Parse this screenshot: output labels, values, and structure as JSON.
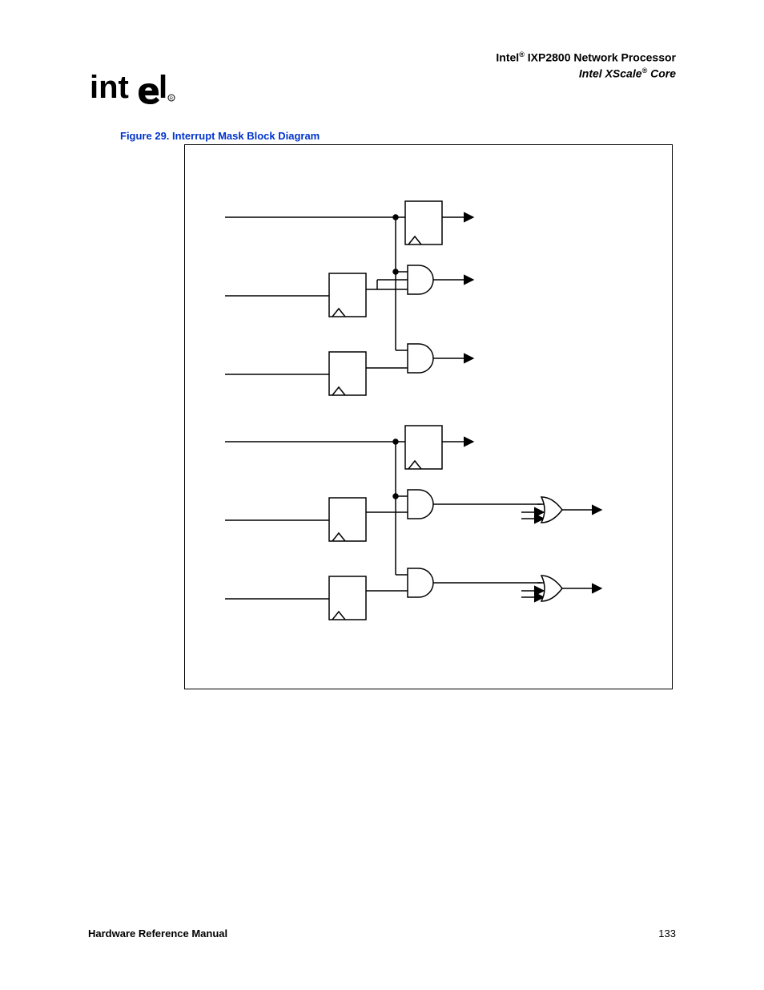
{
  "header": {
    "company": "Intel",
    "reg1": "®",
    "product": " IXP2800 Network Processor",
    "subline_prefix": "Intel XScale",
    "reg2": "®",
    "subline_suffix": " Core"
  },
  "figure": {
    "label": "Figure 29. Interrupt Mask Block Diagram"
  },
  "footer": {
    "left": "Hardware Reference Manual",
    "page": "133"
  }
}
